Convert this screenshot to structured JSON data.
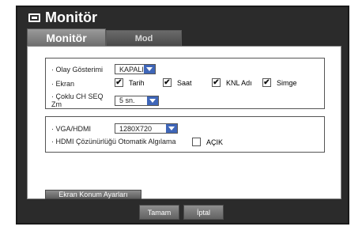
{
  "window": {
    "title": "Monitör",
    "icon": "monitor-icon"
  },
  "tabs": [
    {
      "label": "Monitör",
      "active": true
    },
    {
      "label": "Mod",
      "active": false
    }
  ],
  "display": {
    "event_display_label": "· Olay Gösterimi",
    "event_display_value": "KAPALI",
    "screen_label": "· Ekran",
    "screen_options": [
      {
        "label": "Tarih",
        "checked": true
      },
      {
        "label": "Saat",
        "checked": true
      },
      {
        "label": "KNL Adı",
        "checked": true
      },
      {
        "label": "Simge",
        "checked": true
      }
    ],
    "seq_label": "· Çoklu CH SEQ Zm",
    "seq_value": "5 sn."
  },
  "output": {
    "vga_label": "· VGA/HDMI",
    "vga_value": "1280X720",
    "hdmi_auto_label": "· HDMI Çözünürlüğü Otomatik Algılama",
    "hdmi_auto_option": {
      "label": "AÇIK",
      "checked": false
    }
  },
  "buttons": {
    "screen_position": "Ekran Konum Ayarları",
    "ok": "Tamam",
    "cancel": "İptal"
  },
  "colors": {
    "accent": "#3f66b8",
    "frame": "#2b2b2b"
  }
}
